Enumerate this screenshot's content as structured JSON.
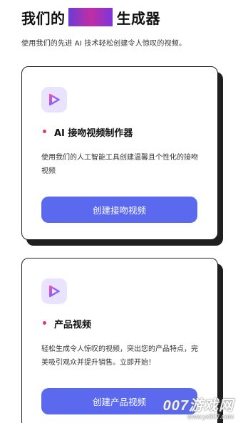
{
  "header": {
    "title_prefix": "我们的",
    "title_suffix": "生成器",
    "subtitle": "使用我们的先进 AI 技术轻松创建令人惊叹的视频。"
  },
  "cards": [
    {
      "heading": "AI 接吻视频制作器",
      "description": "使用我们的人工智能工具创建温馨且个性化的接吻视频",
      "button_label": "创建接吻视频",
      "icon": "play-logo-icon"
    },
    {
      "heading": "产品视频",
      "description": "轻松生成令人惊叹的视频，突出您的产品特点，完美吸引观众并提升销售。立即开始！",
      "button_label": "创建产品视频",
      "icon": "play-logo-icon"
    }
  ],
  "watermark": {
    "brand": "007游戏网",
    "url": "www.yx007.com"
  },
  "colors": {
    "accent_button": "#5b69ee",
    "bullet": "#e2387a",
    "icon_bg": "#eae3ff"
  }
}
